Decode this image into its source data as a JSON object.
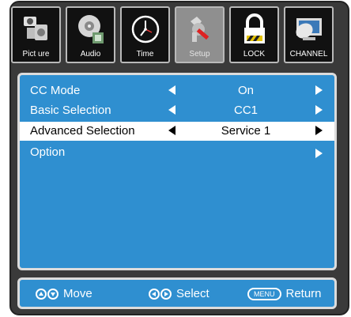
{
  "tabs": [
    {
      "label": "Pict ure",
      "icon": "camera-icon"
    },
    {
      "label": "Audio",
      "icon": "audio-disc-icon"
    },
    {
      "label": "Time",
      "icon": "clock-icon"
    },
    {
      "label": "Setup",
      "icon": "tools-icon"
    },
    {
      "label": "LOCK",
      "icon": "lock-icon"
    },
    {
      "label": "CHANNEL",
      "icon": "satellite-dish-icon"
    }
  ],
  "active_tab": "Setup",
  "menu": [
    {
      "label": "CC Mode",
      "value": "On"
    },
    {
      "label": "Basic Selection",
      "value": "CC1"
    },
    {
      "label": "Advanced Selection",
      "value": "Service 1"
    },
    {
      "label": "Option",
      "value": ""
    }
  ],
  "footer": {
    "move": "Move",
    "select": "Select",
    "menu_key": "MENU",
    "return": "Return"
  },
  "colors": {
    "panel": "#2f8fd0",
    "frame": "#3a3a3a",
    "tab_bg": "#111111",
    "tab_active": "#8f8f8f",
    "selected_row": "#ffffff"
  }
}
